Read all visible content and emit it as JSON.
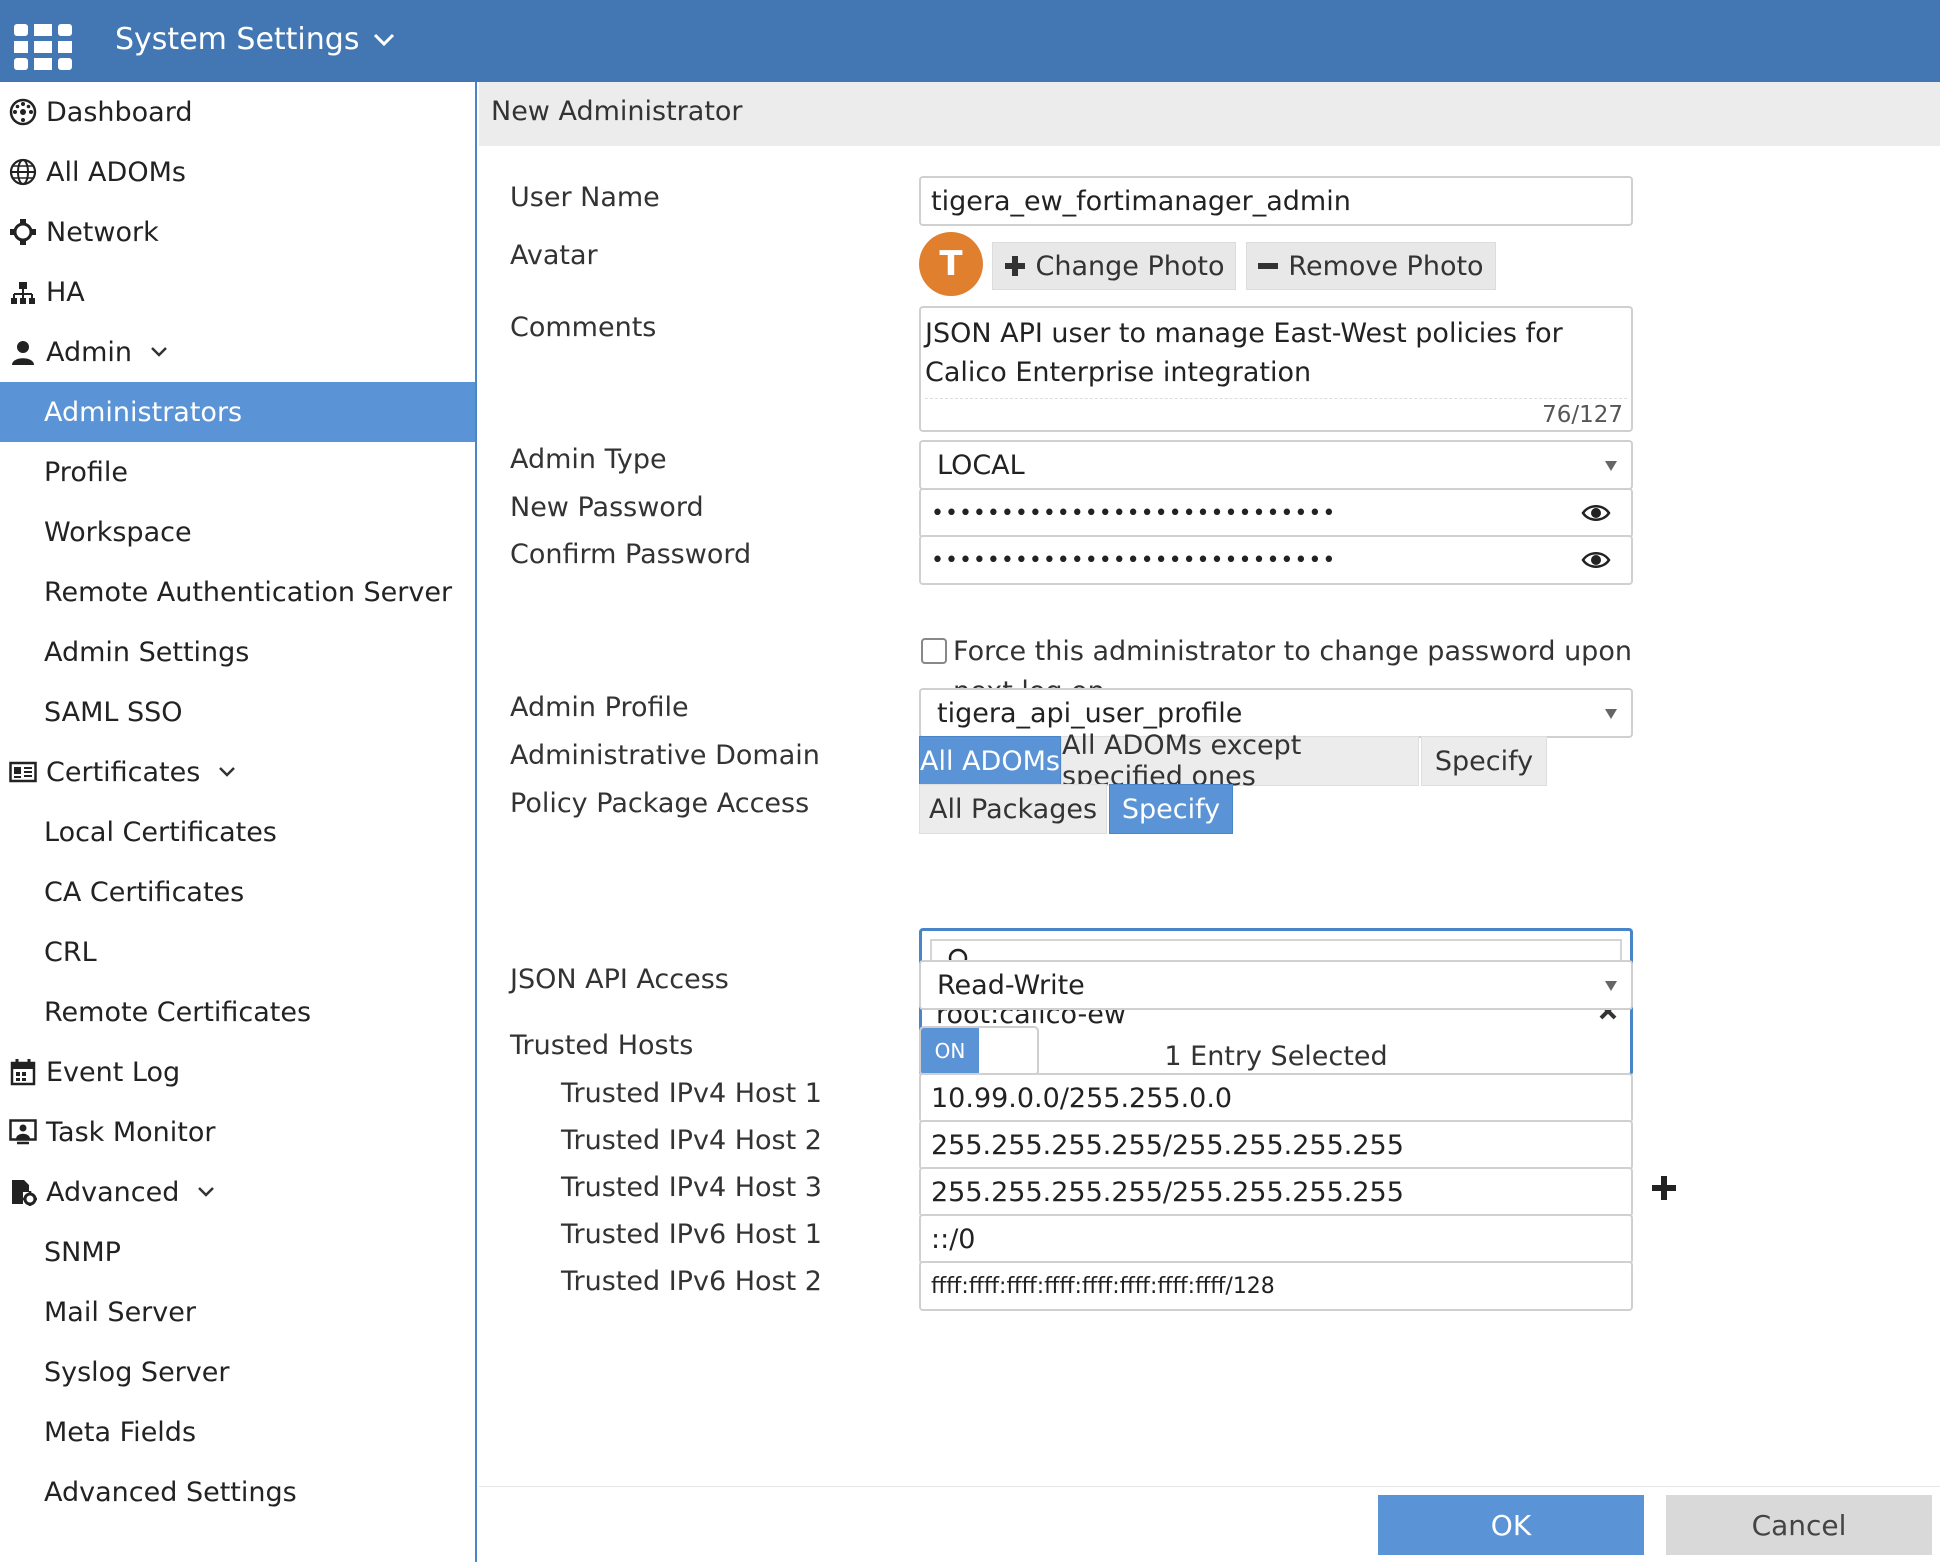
{
  "app": {
    "title": "System Settings",
    "accent_color": "#4277b3",
    "selection_color": "#5a94d6",
    "avatar_color": "#e07f2e"
  },
  "sidebar": {
    "items": [
      {
        "label": "Dashboard",
        "icon": "dashboard-icon"
      },
      {
        "label": "All ADOMs",
        "icon": "globe-icon"
      },
      {
        "label": "Network",
        "icon": "network-icon"
      },
      {
        "label": "HA",
        "icon": "ha-icon"
      },
      {
        "label": "Admin",
        "icon": "user-icon",
        "expanded": true
      },
      {
        "label": "Administrators",
        "active": true
      },
      {
        "label": "Profile"
      },
      {
        "label": "Workspace"
      },
      {
        "label": "Remote Authentication Server"
      },
      {
        "label": "Admin Settings"
      },
      {
        "label": "SAML SSO"
      },
      {
        "label": "Certificates",
        "icon": "certificate-icon",
        "expanded": true
      },
      {
        "label": "Local Certificates"
      },
      {
        "label": "CA Certificates"
      },
      {
        "label": "CRL"
      },
      {
        "label": "Remote Certificates"
      },
      {
        "label": "Event Log",
        "icon": "calendar-icon"
      },
      {
        "label": "Task Monitor",
        "icon": "task-monitor-icon"
      },
      {
        "label": "Advanced",
        "icon": "advanced-settings-icon",
        "expanded": true
      },
      {
        "label": "SNMP"
      },
      {
        "label": "Mail Server"
      },
      {
        "label": "Syslog Server"
      },
      {
        "label": "Meta Fields"
      },
      {
        "label": "Advanced Settings"
      }
    ]
  },
  "form": {
    "title": "New Administrator",
    "labels": {
      "user_name": "User Name",
      "avatar": "Avatar",
      "comments": "Comments",
      "admin_type": "Admin Type",
      "new_password": "New Password",
      "confirm_password": "Confirm Password",
      "admin_profile": "Admin Profile",
      "administrative_domain": "Administrative Domain",
      "policy_package_access": "Policy Package Access",
      "json_api_access": "JSON API Access",
      "trusted_hosts": "Trusted Hosts",
      "trusted_ipv4_host_1": "Trusted IPv4 Host 1",
      "trusted_ipv4_host_2": "Trusted IPv4 Host 2",
      "trusted_ipv4_host_3": "Trusted IPv4 Host 3",
      "trusted_ipv6_host_1": "Trusted IPv6 Host 1",
      "trusted_ipv6_host_2": "Trusted IPv6 Host 2"
    },
    "user_name": "tigera_ew_fortimanager_admin",
    "avatar_initial": "T",
    "change_photo": "Change Photo",
    "remove_photo": "Remove Photo",
    "comments": "JSON API user to manage East-West policies for Calico Enterprise integration",
    "comments_count": "76/127",
    "admin_type": "LOCAL",
    "new_password": "•••••••••••••••••••••••••••••",
    "confirm_password": "•••••••••••••••••••••••••••••",
    "force_change_label": "Force this administrator to change password upon next log on.",
    "force_change_checked": false,
    "admin_profile": "tigera_api_user_profile",
    "adom_options": [
      "All ADOMs",
      "All ADOMs except specified ones",
      "Specify"
    ],
    "adom_selected": "All ADOMs",
    "package_options": [
      "All Packages",
      "Specify"
    ],
    "package_selected": "Specify",
    "package_search_value": "",
    "package_entry": "root:calico-ew",
    "package_selected_count": "1 Entry Selected",
    "json_api_access": "Read-Write",
    "trusted_hosts_toggle": "ON",
    "trusted_ipv4_host_1": "10.99.0.0/255.255.0.0",
    "trusted_ipv4_host_2": "255.255.255.255/255.255.255.255",
    "trusted_ipv4_host_3": "255.255.255.255/255.255.255.255",
    "trusted_ipv6_host_1": "::/0",
    "trusted_ipv6_host_2": "ffff:ffff:ffff:ffff:ffff:ffff:ffff:ffff/128"
  },
  "footer": {
    "ok": "OK",
    "cancel": "Cancel"
  }
}
